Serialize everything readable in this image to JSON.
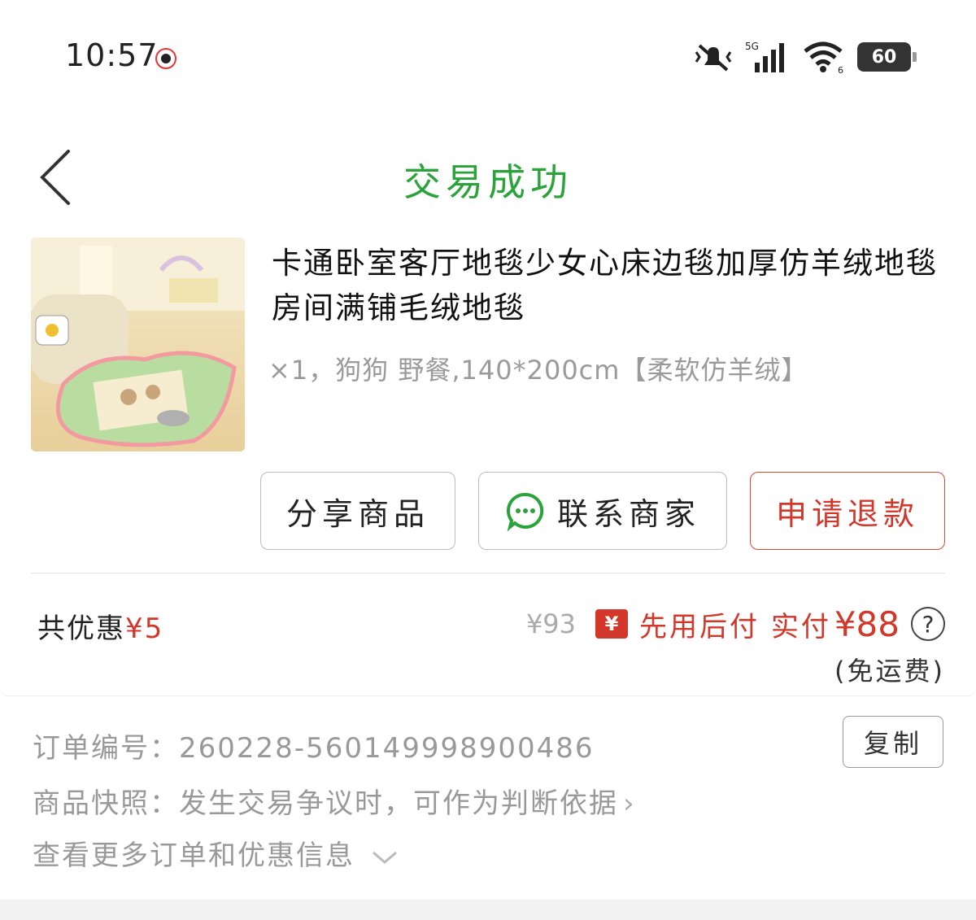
{
  "status": {
    "time": "10:57",
    "battery": "60",
    "network": "5G",
    "wifi_level": "6"
  },
  "header": {
    "title": "交易成功"
  },
  "product": {
    "title": "卡通卧室客厅地毯少女心床边毯加厚仿羊绒地毯房间满铺毛绒地毯",
    "spec": "×1，狗狗 野餐,140*200cm【柔软仿羊绒】",
    "image_icon": "product-thumbnail"
  },
  "actions": {
    "share": "分享商品",
    "contact": "联系商家",
    "refund": "申请退款"
  },
  "price": {
    "discount_label": "共优惠",
    "discount_amount": "¥5",
    "original": "¥93",
    "pay_badge": "¥",
    "pay_label": "先用后付 实付",
    "paid": "¥88",
    "help": "?",
    "shipping": "(免运费)"
  },
  "order": {
    "number_label": "订单编号：",
    "number": "260228-560149998900486",
    "copy": "复制",
    "snapshot": "商品快照：发生交易争议时，可作为判断依据",
    "more": "查看更多订单和优惠信息"
  },
  "colors": {
    "success_green": "#2aa33a",
    "accent_red": "#d3372a"
  }
}
